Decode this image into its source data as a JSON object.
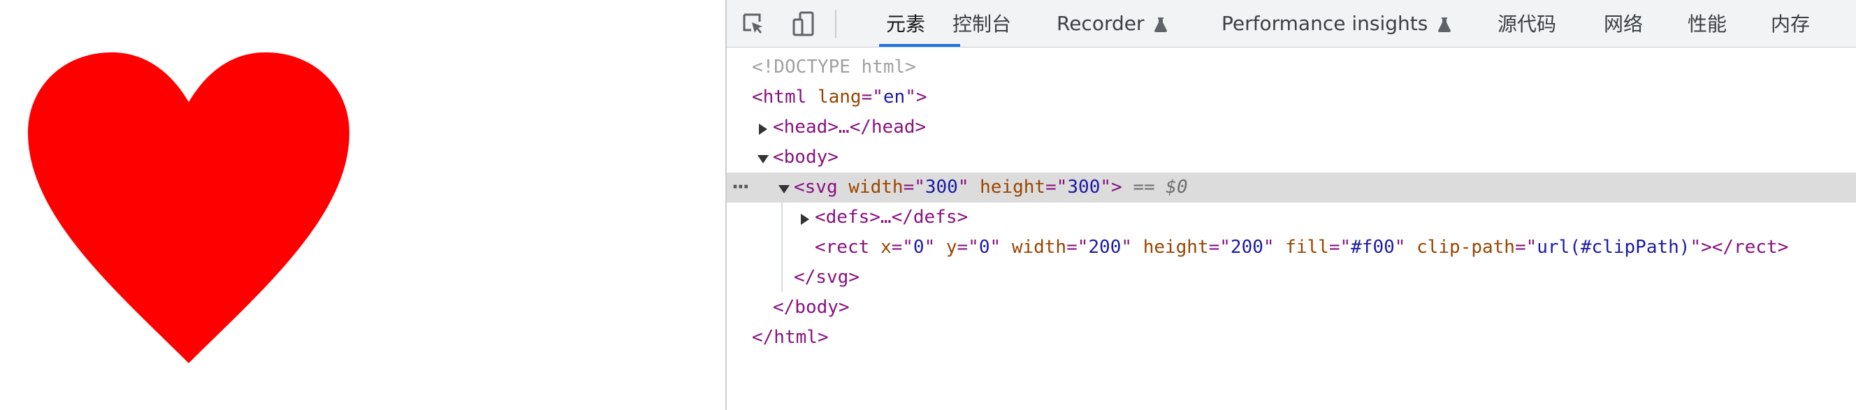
{
  "page": {
    "heart_color": "#ff0000"
  },
  "devtools": {
    "toolbar": {
      "inspect_icon": "inspect-element-icon",
      "device_icon": "device-toolbar-icon",
      "tabs": [
        {
          "label": "元素",
          "active": true
        },
        {
          "label": "控制台",
          "active": false
        },
        {
          "label": "Recorder",
          "active": false,
          "experimental": true
        },
        {
          "label": "Performance insights",
          "active": false,
          "experimental": true
        },
        {
          "label": "源代码",
          "active": false
        },
        {
          "label": "网络",
          "active": false
        },
        {
          "label": "性能",
          "active": false
        },
        {
          "label": "内存",
          "active": false
        }
      ],
      "accent_color": "#1a73e8"
    },
    "tree": {
      "doctype": "<!DOCTYPE html>",
      "html_open": {
        "tag": "<html",
        "attr": "lang",
        "eq": "=\"",
        "val": "en",
        "close": "\">"
      },
      "head": "<head>…</head>",
      "body_open": "<body>",
      "svg_open": {
        "tag": "<svg",
        "attr1": "width",
        "val1": "300",
        "attr2": "height",
        "val2": "300",
        "close": ">",
        "ref": "== $0"
      },
      "defs": "<defs>…</defs>",
      "rect": {
        "tag": "<rect",
        "x_attr": "x",
        "x_val": "0",
        "y_attr": "y",
        "y_val": "0",
        "w_attr": "width",
        "w_val": "200",
        "h_attr": "height",
        "h_val": "200",
        "fill_attr": "fill",
        "fill_val": "#f00",
        "clip_attr": "clip-path",
        "clip_val": "url(#clipPath)",
        "close": "></rect>"
      },
      "svg_close": "</svg>",
      "body_close": "</body>",
      "html_close": "</html>",
      "more_dots": "···"
    }
  }
}
